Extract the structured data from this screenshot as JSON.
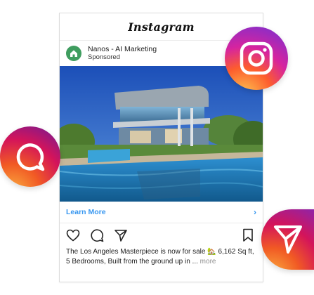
{
  "header": {
    "wordmark": "Instagram"
  },
  "post": {
    "account_name": "Nanos - AI Marketing",
    "sponsored": "Sponsored",
    "cta_label": "Learn More",
    "cta_chevron": "›",
    "caption_text": "The Los Angeles Masterpiece is now for sale 🏡 6,162 Sq ft, 5 Bedrooms, Built from the ground up in ...",
    "caption_more": "more"
  },
  "icons": {
    "like": "heart-icon",
    "comment": "comment-icon",
    "share": "send-icon",
    "save": "bookmark-icon",
    "avatar": "house-logo-icon",
    "bubble_top": "instagram-logo-icon",
    "bubble_left": "chat-bubble-icon",
    "bubble_right": "paper-plane-icon"
  },
  "colors": {
    "link": "#3897f0",
    "avatar_bg": "#3f9d5f",
    "sky": "#2a63c4",
    "pool": "#1e7fb5"
  }
}
